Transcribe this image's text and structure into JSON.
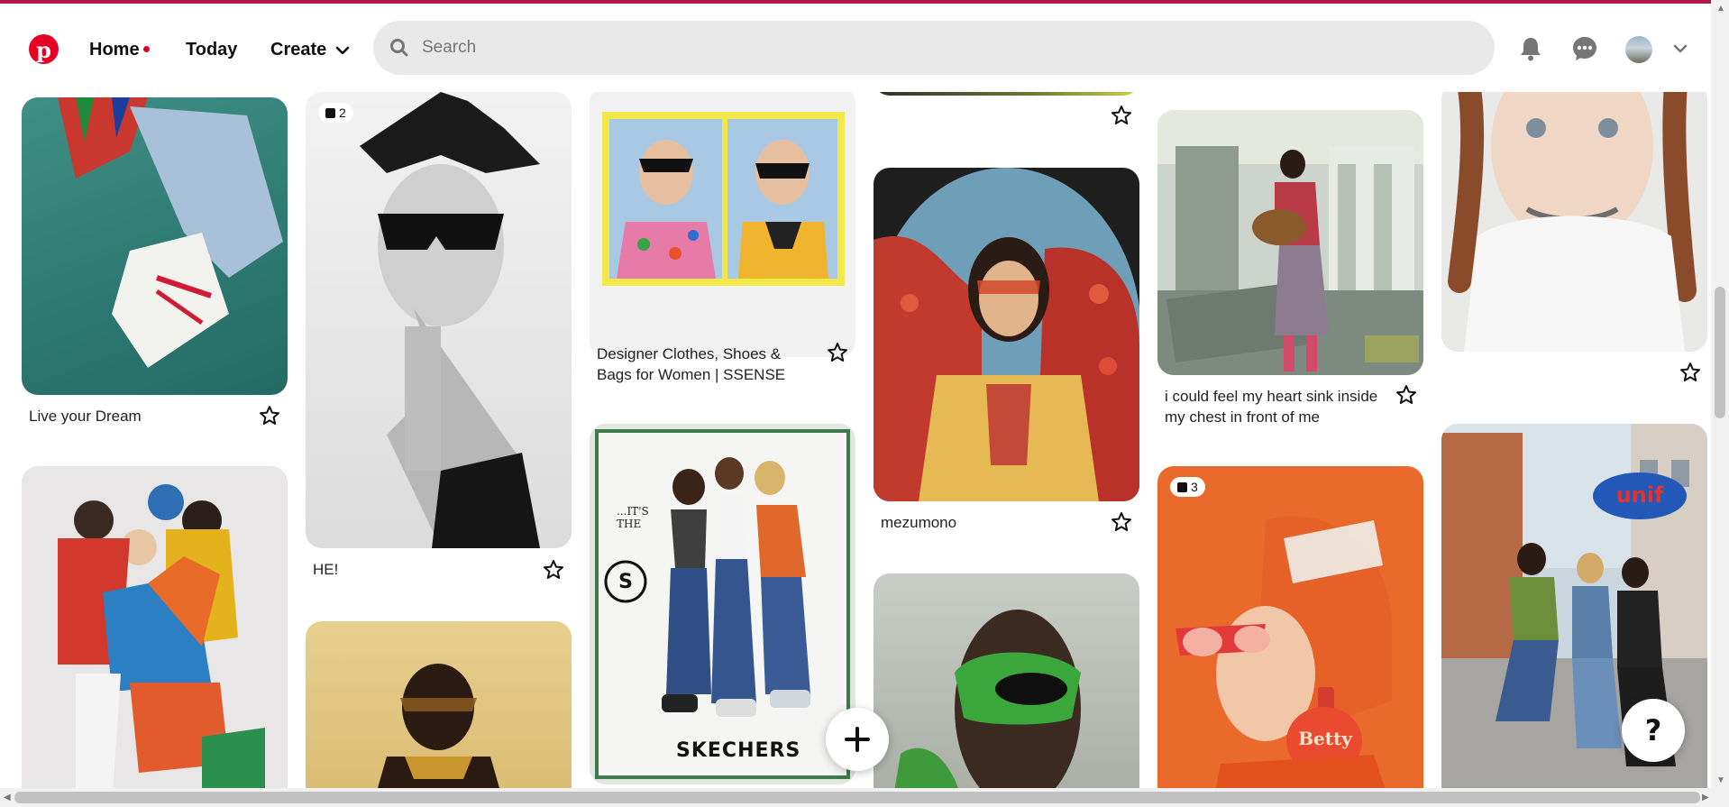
{
  "colors": {
    "brand": "#e60023",
    "topline": "#b0164e"
  },
  "header": {
    "logo_letter": "p",
    "nav": {
      "home": "Home",
      "today": "Today",
      "create": "Create"
    },
    "search_placeholder": "Search",
    "icons": [
      "search-icon",
      "bell-icon",
      "messages-icon",
      "avatar",
      "chevron-down-icon"
    ]
  },
  "pins": {
    "p1": {
      "caption": "Live your Dream"
    },
    "p2": {
      "badge": "2",
      "caption": "HE!"
    },
    "p3": {
      "caption": "Designer Clothes, Shoes & Bags for Women | SSENSE"
    },
    "p4": {
      "caption": "mezumono"
    },
    "p5": {
      "caption": "i could feel my heart sink inside my chest in front of me"
    },
    "p6": {
      "badge": "3"
    },
    "p7": {
      "image_text": "...IT'S THE",
      "brand_text": "SKECHERS"
    },
    "p8": {
      "image_text": "unif"
    },
    "p9": {
      "image_text": "Betty"
    }
  },
  "fab": {
    "add": "+",
    "help": "?"
  }
}
